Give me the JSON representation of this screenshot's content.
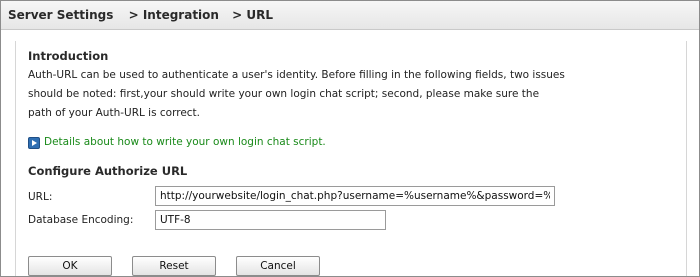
{
  "breadcrumb": {
    "root": "Server Settings",
    "level1": "> Integration",
    "level2": "> URL"
  },
  "intro": {
    "title": "Introduction",
    "lines": [
      "Auth-URL can be used to authenticate a user's identity. Before filling in the following fields, two issues",
      "should be noted: first,your should write your own login chat script; second, please make sure the",
      "path of your Auth-URL is correct."
    ]
  },
  "details_link": {
    "icon": "play-icon",
    "label": "Details about how to write your own login chat script."
  },
  "configure": {
    "title": "Configure Authorize URL",
    "url_label": "URL:",
    "url_value": "http://yourwebsite/login_chat.php?username=%username%&password=%passw",
    "encoding_label": "Database Encoding:",
    "encoding_value": "UTF-8"
  },
  "buttons": {
    "ok": "OK",
    "reset": "Reset",
    "cancel": "Cancel"
  },
  "colors": {
    "link": "#1a8a1a",
    "icon": "#2f6fb3"
  }
}
